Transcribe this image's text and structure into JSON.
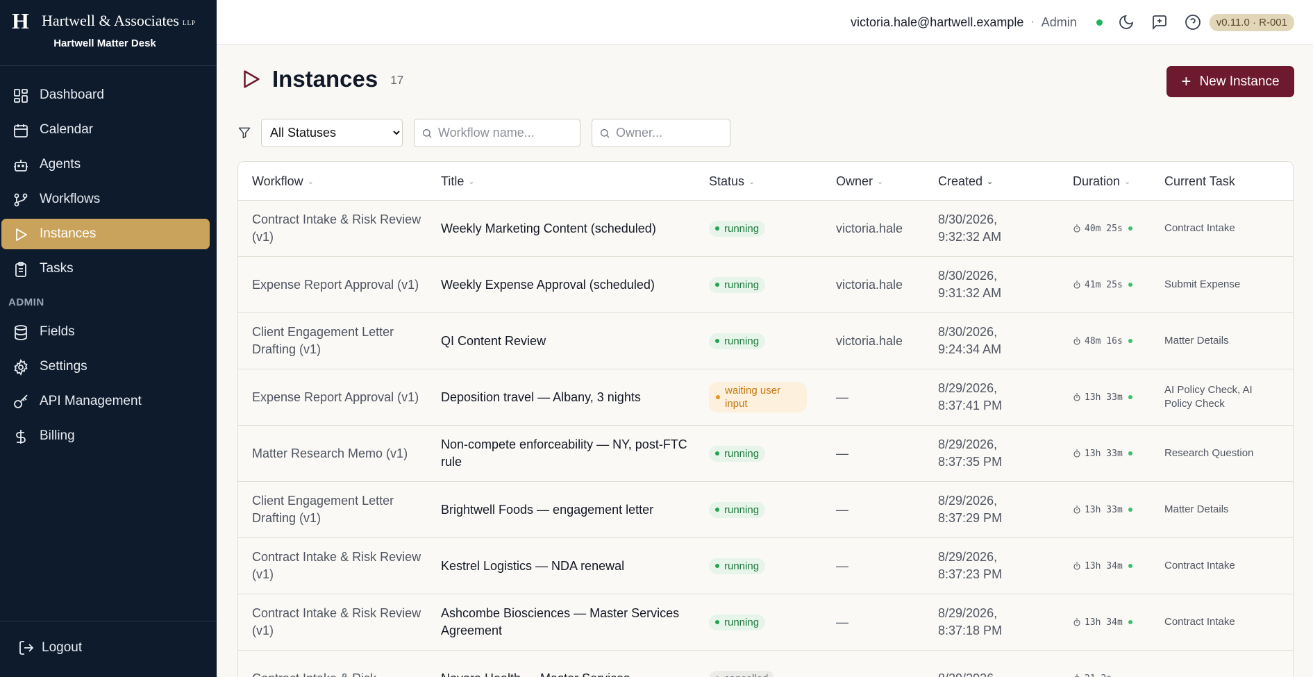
{
  "brand": {
    "mark": "H",
    "name": "Hartwell & Associates",
    "suffix": "LLP",
    "subtitle": "Hartwell Matter Desk"
  },
  "sidebar": {
    "items": [
      {
        "label": "Dashboard",
        "icon": "dashboard-icon",
        "active": false
      },
      {
        "label": "Calendar",
        "icon": "calendar-icon",
        "active": false
      },
      {
        "label": "Agents",
        "icon": "bot-icon",
        "active": false
      },
      {
        "label": "Workflows",
        "icon": "workflow-icon",
        "active": false
      },
      {
        "label": "Instances",
        "icon": "play-icon",
        "active": true
      },
      {
        "label": "Tasks",
        "icon": "clipboard-icon",
        "active": false
      }
    ],
    "admin_label": "ADMIN",
    "admin_items": [
      {
        "label": "Fields",
        "icon": "database-icon"
      },
      {
        "label": "Settings",
        "icon": "gear-icon"
      },
      {
        "label": "API Management",
        "icon": "key-icon"
      },
      {
        "label": "Billing",
        "icon": "dollar-icon"
      }
    ],
    "logout_label": "Logout"
  },
  "topbar": {
    "email": "victoria.hale@hartwell.example",
    "separator": "·",
    "role": "Admin",
    "version": "v0.11.0 · R-001"
  },
  "page": {
    "title": "Instances",
    "count": "17",
    "new_button": "New Instance"
  },
  "filters": {
    "status_options": [
      "All Statuses"
    ],
    "status_selected": "All Statuses",
    "workflow_placeholder": "Workflow name...",
    "owner_placeholder": "Owner..."
  },
  "table": {
    "columns": {
      "workflow": "Workflow",
      "title": "Title",
      "status": "Status",
      "owner": "Owner",
      "created": "Created",
      "duration": "Duration",
      "current_task": "Current Task"
    },
    "rows": [
      {
        "workflow": "Contract Intake & Risk Review (v1)",
        "title": "Weekly Marketing Content (scheduled)",
        "status": "running",
        "owner": "victoria.hale",
        "created": "8/30/2026, 9:32:32 AM",
        "duration": "40m 25s",
        "task": "Contract Intake"
      },
      {
        "workflow": "Expense Report Approval (v1)",
        "title": "Weekly Expense Approval (scheduled)",
        "status": "running",
        "owner": "victoria.hale",
        "created": "8/30/2026, 9:31:32 AM",
        "duration": "41m 25s",
        "task": "Submit Expense"
      },
      {
        "workflow": "Client Engagement Letter Drafting (v1)",
        "title": "QI Content Review",
        "status": "running",
        "owner": "victoria.hale",
        "created": "8/30/2026, 9:24:34 AM",
        "duration": "48m 16s",
        "task": "Matter Details"
      },
      {
        "workflow": "Expense Report Approval (v1)",
        "title": "Deposition travel — Albany, 3 nights",
        "status": "waiting user input",
        "owner": "—",
        "created": "8/29/2026, 8:37:41 PM",
        "duration": "13h 33m",
        "task": "AI Policy Check, AI Policy Check"
      },
      {
        "workflow": "Matter Research Memo (v1)",
        "title": "Non-compete enforceability — NY, post-FTC rule",
        "status": "running",
        "owner": "—",
        "created": "8/29/2026, 8:37:35 PM",
        "duration": "13h 33m",
        "task": "Research Question"
      },
      {
        "workflow": "Client Engagement Letter Drafting (v1)",
        "title": "Brightwell Foods — engagement letter",
        "status": "running",
        "owner": "—",
        "created": "8/29/2026, 8:37:29 PM",
        "duration": "13h 33m",
        "task": "Matter Details"
      },
      {
        "workflow": "Contract Intake & Risk Review (v1)",
        "title": "Kestrel Logistics — NDA renewal",
        "status": "running",
        "owner": "—",
        "created": "8/29/2026, 8:37:23 PM",
        "duration": "13h 34m",
        "task": "Contract Intake"
      },
      {
        "workflow": "Contract Intake & Risk Review (v1)",
        "title": "Ashcombe Biosciences — Master Services Agreement",
        "status": "running",
        "owner": "—",
        "created": "8/29/2026, 8:37:18 PM",
        "duration": "13h 34m",
        "task": "Contract Intake"
      },
      {
        "workflow": "Contract Intake & Risk",
        "title": "Novara Health — Master Services",
        "status": "cancelled",
        "owner": "",
        "created": "8/29/2026,",
        "duration": "21.2s",
        "task": ""
      }
    ]
  }
}
